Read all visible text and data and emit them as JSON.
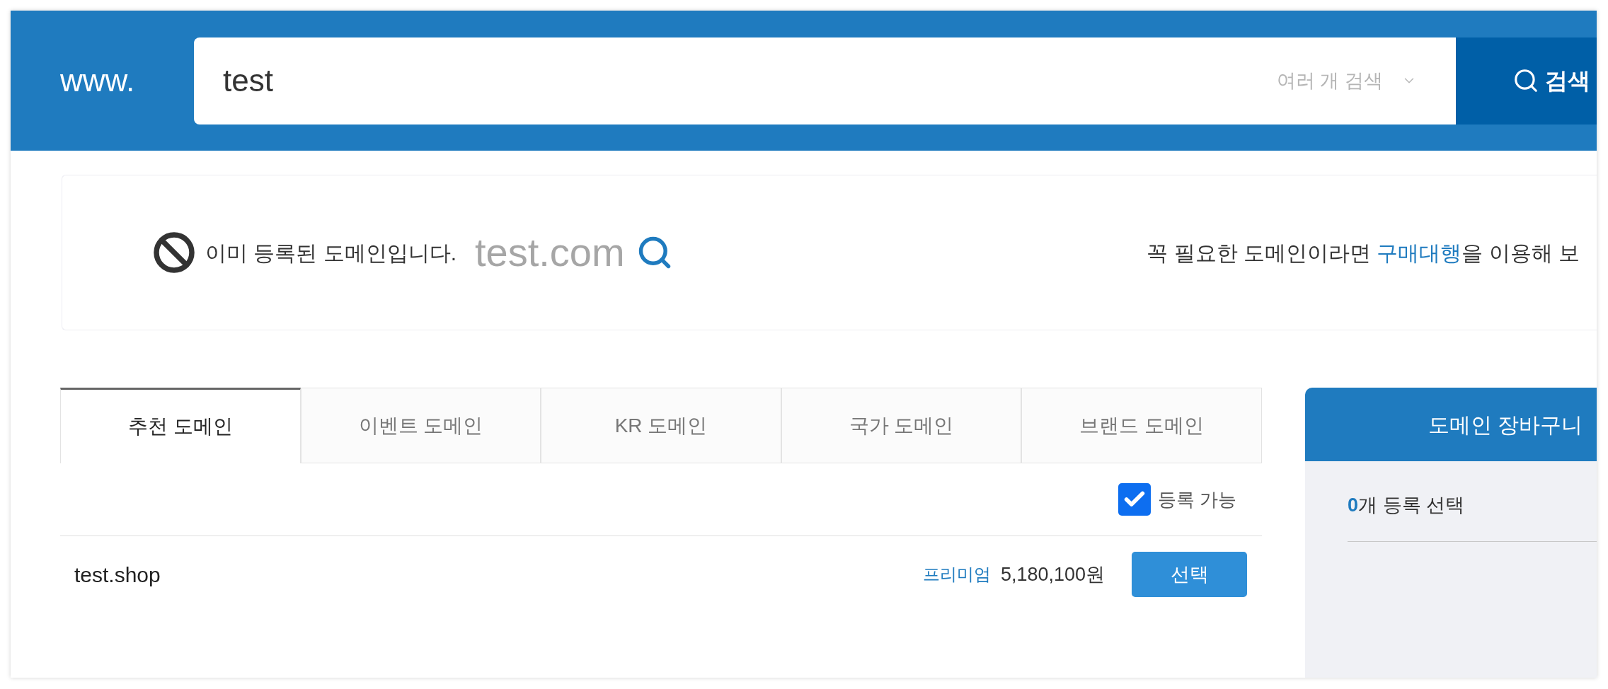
{
  "header": {
    "prefix": "www.",
    "search": {
      "value": "test"
    },
    "multi_search": {
      "label": "여러 개 검색"
    },
    "search_button": {
      "label": "검색"
    }
  },
  "result": {
    "message": "이미 등록된 도메인입니다.",
    "domain": "test.com",
    "hint": {
      "before": "꼭 필요한 도메인이라면 ",
      "link": "구매대행",
      "after": "을 이용해 보"
    }
  },
  "tabs": [
    {
      "label": "추천 도메인",
      "selected": true
    },
    {
      "label": "이벤트 도메인",
      "selected": false
    },
    {
      "label": "KR 도메인",
      "selected": false
    },
    {
      "label": "국가 도메인",
      "selected": false
    },
    {
      "label": "브랜드 도메인",
      "selected": false
    }
  ],
  "filter": {
    "label": "등록 가능",
    "checked": true
  },
  "domains": [
    {
      "name": "test.shop",
      "badge": "프리미엄",
      "price": "5,180,100원",
      "button": "선택"
    }
  ],
  "cart": {
    "title": "도메인 장바구니",
    "selected_count": "0",
    "selected_label": "개 등록 선택"
  }
}
